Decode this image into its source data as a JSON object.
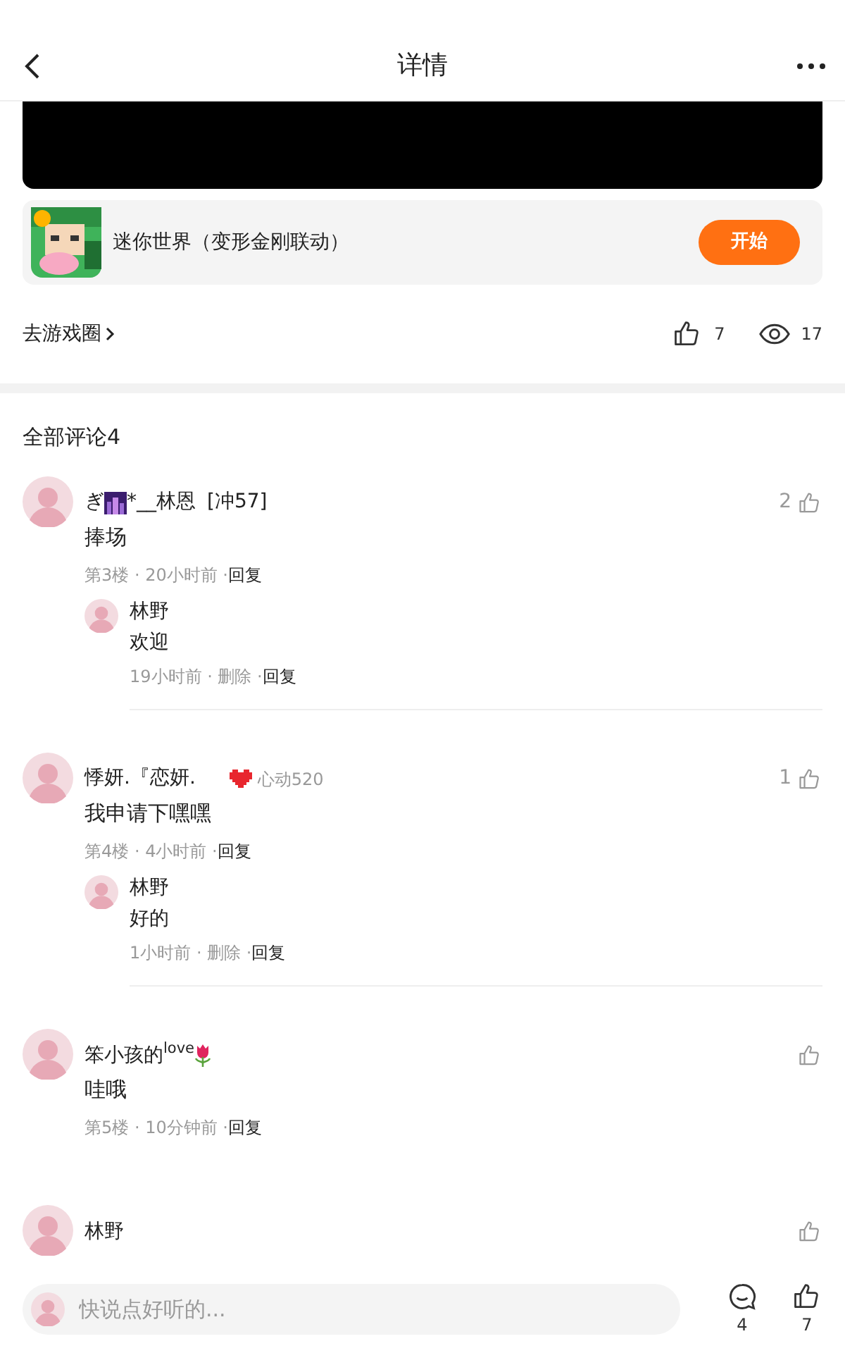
{
  "header": {
    "title": "详情"
  },
  "game": {
    "name": "迷你世界（变形金刚联动）",
    "button": "开始"
  },
  "stats": {
    "circle_link": "去游戏圈",
    "likes": "7",
    "views": "17"
  },
  "comments_title": "全部评论4",
  "comments": [
    {
      "name_lead": "ぎ",
      "name": "*__林恩",
      "tag": "[冲57]",
      "text": "捧场",
      "meta": "第3楼 · 20小时前 ·",
      "reply": "回复",
      "likes": "2",
      "replies": [
        {
          "name": "林野",
          "text": "欢迎",
          "meta": "19小时前 · 删除 ·",
          "reply": "回复"
        }
      ]
    },
    {
      "name": "悸妍.『恋妍.",
      "badge": "心动520",
      "text": "我申请下嘿嘿",
      "meta": "第4楼 · 4小时前 ·",
      "reply": "回复",
      "likes": "1",
      "replies": [
        {
          "name": "林野",
          "text": "好的",
          "meta": "1小时前 · 删除 ·",
          "reply": "回复"
        }
      ]
    },
    {
      "name": "笨小孩的$^{love}$",
      "flower": true,
      "text": "哇哦",
      "meta": "第5楼 · 10分钟前 ·",
      "reply": "回复"
    },
    {
      "name": "林野"
    }
  ],
  "bottom": {
    "placeholder": "快说点好听的...",
    "comments": "4",
    "likes": "7"
  }
}
